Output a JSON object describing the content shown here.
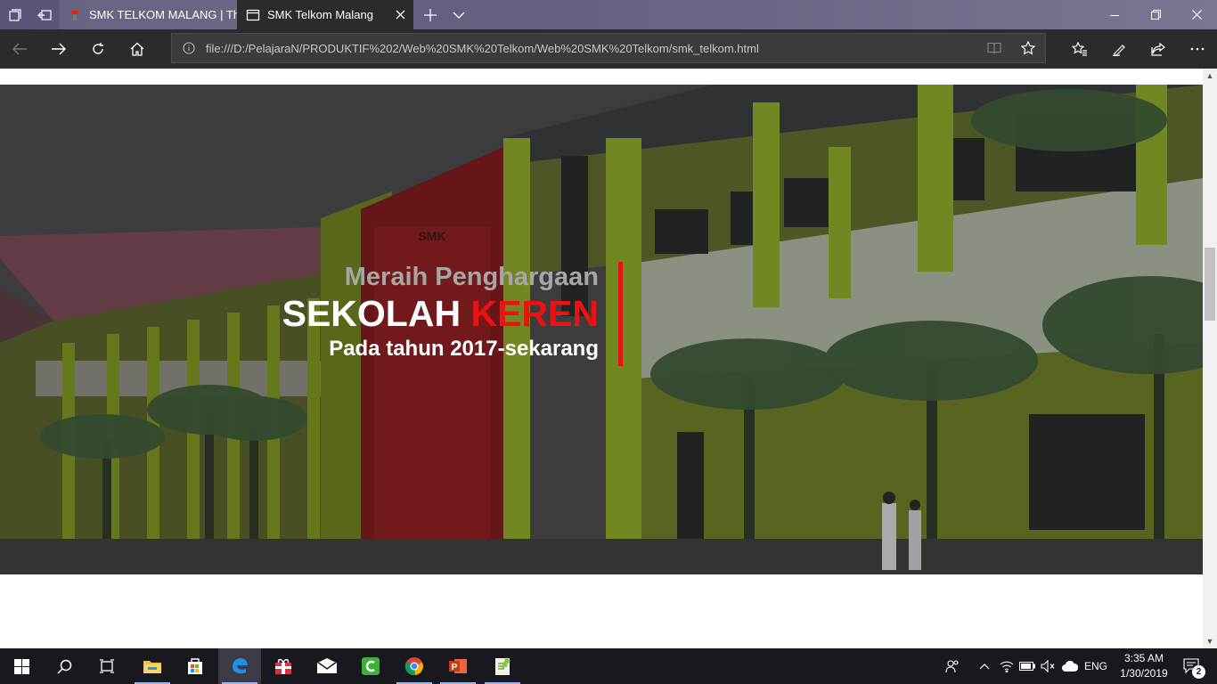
{
  "browser": {
    "tabs": [
      {
        "title": "SMK TELKOM MALANG | Th",
        "active": false
      },
      {
        "title": "SMK Telkom Malang",
        "active": true
      }
    ],
    "address": "file:///D:/PelajaraN/PRODUKTIF%202/Web%20SMK%20Telkom/Web%20SMK%20Telkom/smk_telkom.html"
  },
  "hero": {
    "line1": "Meraih Penghargaan",
    "main_white": "SEKOLAH",
    "main_red": "KEREN",
    "line3": "Pada tahun 2017-sekarang",
    "accent_color": "#e41313"
  },
  "taskbar": {
    "language": "ENG",
    "time": "3:35 AM",
    "date": "1/30/2019",
    "notifications": "2"
  }
}
